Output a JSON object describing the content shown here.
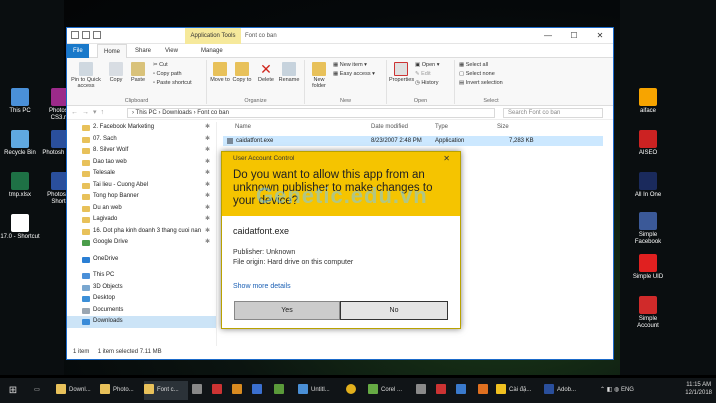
{
  "desktop_left": [
    {
      "label": "This PC",
      "color": "#4a90d9"
    },
    {
      "label": "Photosh CS3.ra",
      "color": "#9c2a8a"
    },
    {
      "label": "Recycle Bin",
      "color": "#5fa8e0"
    },
    {
      "label": "Photosh CS3",
      "color": "#2a4f9c"
    },
    {
      "label": "tmp.xlsx",
      "color": "#1e7145"
    },
    {
      "label": "Photosh - Shortc",
      "color": "#2a4f9c"
    },
    {
      "label": "17.0 - Shortcut",
      "color": "#ffffff"
    }
  ],
  "desktop_right": [
    {
      "label": "aiface",
      "color": "#f7a400"
    },
    {
      "label": "AISEO",
      "color": "#cc2222"
    },
    {
      "label": "All In One",
      "color": "#1a2a5c"
    },
    {
      "label": "Simple Facebook",
      "color": "#3b5998"
    },
    {
      "label": "Simple UID",
      "color": "#e02020"
    },
    {
      "label": "Simple Account",
      "color": "#d02a2a"
    }
  ],
  "window": {
    "app_tools": "Application Tools",
    "title": "Font co ban",
    "controls": [
      "—",
      "☐",
      "✕"
    ],
    "tabs": [
      "File",
      "Home",
      "Share",
      "View",
      "Manage"
    ]
  },
  "ribbon": {
    "clipboard": {
      "pin": "Pin to Quick access",
      "copy": "Copy",
      "paste": "Paste",
      "cut": "Cut",
      "copy_path": "Copy path",
      "paste_shortcut": "Paste shortcut",
      "label": "Clipboard"
    },
    "organize": {
      "move_to": "Move to",
      "copy_to": "Copy to",
      "delete": "Delete",
      "rename": "Rename",
      "label": "Organize"
    },
    "new": {
      "new_folder": "New folder",
      "new_item": "New item",
      "easy_access": "Easy access",
      "label": "New"
    },
    "open": {
      "properties": "Properties",
      "open": "Open",
      "edit": "Edit",
      "history": "History",
      "label": "Open"
    },
    "select": {
      "select_all": "Select all",
      "select_none": "Select none",
      "invert": "Invert selection",
      "label": "Select"
    }
  },
  "address": {
    "path": "› This PC › Downloads › Font co ban",
    "search_placeholder": "Search Font co ban"
  },
  "nav_items": [
    {
      "label": "2. Facebook Marketing",
      "pin": true
    },
    {
      "label": "07. Sach",
      "pin": true
    },
    {
      "label": "8. Silver Wolf",
      "pin": true
    },
    {
      "label": "Dao tao web",
      "pin": true
    },
    {
      "label": "Telesale",
      "pin": true
    },
    {
      "label": "Tai lieu - Cuong Abel",
      "pin": true
    },
    {
      "label": "Tong hop Banner",
      "pin": true
    },
    {
      "label": "Du an web",
      "pin": true
    },
    {
      "label": "Lagivado",
      "pin": true
    },
    {
      "label": "16. Dot pha kinh doanh 3 thang cuoi nan",
      "pin": true
    },
    {
      "label": "Google Drive",
      "pin": true
    },
    {
      "label": "OneDrive",
      "pin": false
    },
    {
      "label": "This PC",
      "pin": false
    },
    {
      "label": "3D Objects",
      "pin": false
    },
    {
      "label": "Desktop",
      "pin": false
    },
    {
      "label": "Documents",
      "pin": false
    },
    {
      "label": "Downloads",
      "pin": false
    }
  ],
  "columns": {
    "name": "Name",
    "date": "Date modified",
    "type": "Type",
    "size": "Size"
  },
  "file": {
    "name": "caidatfont.exe",
    "date": "8/23/2007 2:48 PM",
    "type": "Application",
    "size": "7,283 KB"
  },
  "status": {
    "count": "1 item",
    "selected": "1 item selected  7.11 MB"
  },
  "uac": {
    "title": "User Account Control",
    "close": "✕",
    "question": "Do you want to allow this app from an unknown publisher to make changes to your device?",
    "app_name": "caidatfont.exe",
    "publisher": "Publisher: Unknown",
    "origin": "File origin: Hard drive on this computer",
    "more": "Show more details",
    "yes": "Yes",
    "no": "No"
  },
  "watermark": "Genetic.edu.vn",
  "taskbar": {
    "items": [
      {
        "label": "Downl...",
        "color": "#e8c15a"
      },
      {
        "label": "Photo...",
        "color": "#e8c15a"
      },
      {
        "label": "Font c...",
        "color": "#e8c15a"
      },
      {
        "label": "Untitl...",
        "color": "#4a8fd6"
      },
      {
        "label": "Corel ...",
        "color": "#66aa44"
      },
      {
        "label": "Cài đặ...",
        "color": "#f0c020"
      },
      {
        "label": "Adob...",
        "color": "#2a4f9c"
      }
    ],
    "lang": "ENG",
    "time": "11:15 AM",
    "date": "12/1/2018"
  }
}
